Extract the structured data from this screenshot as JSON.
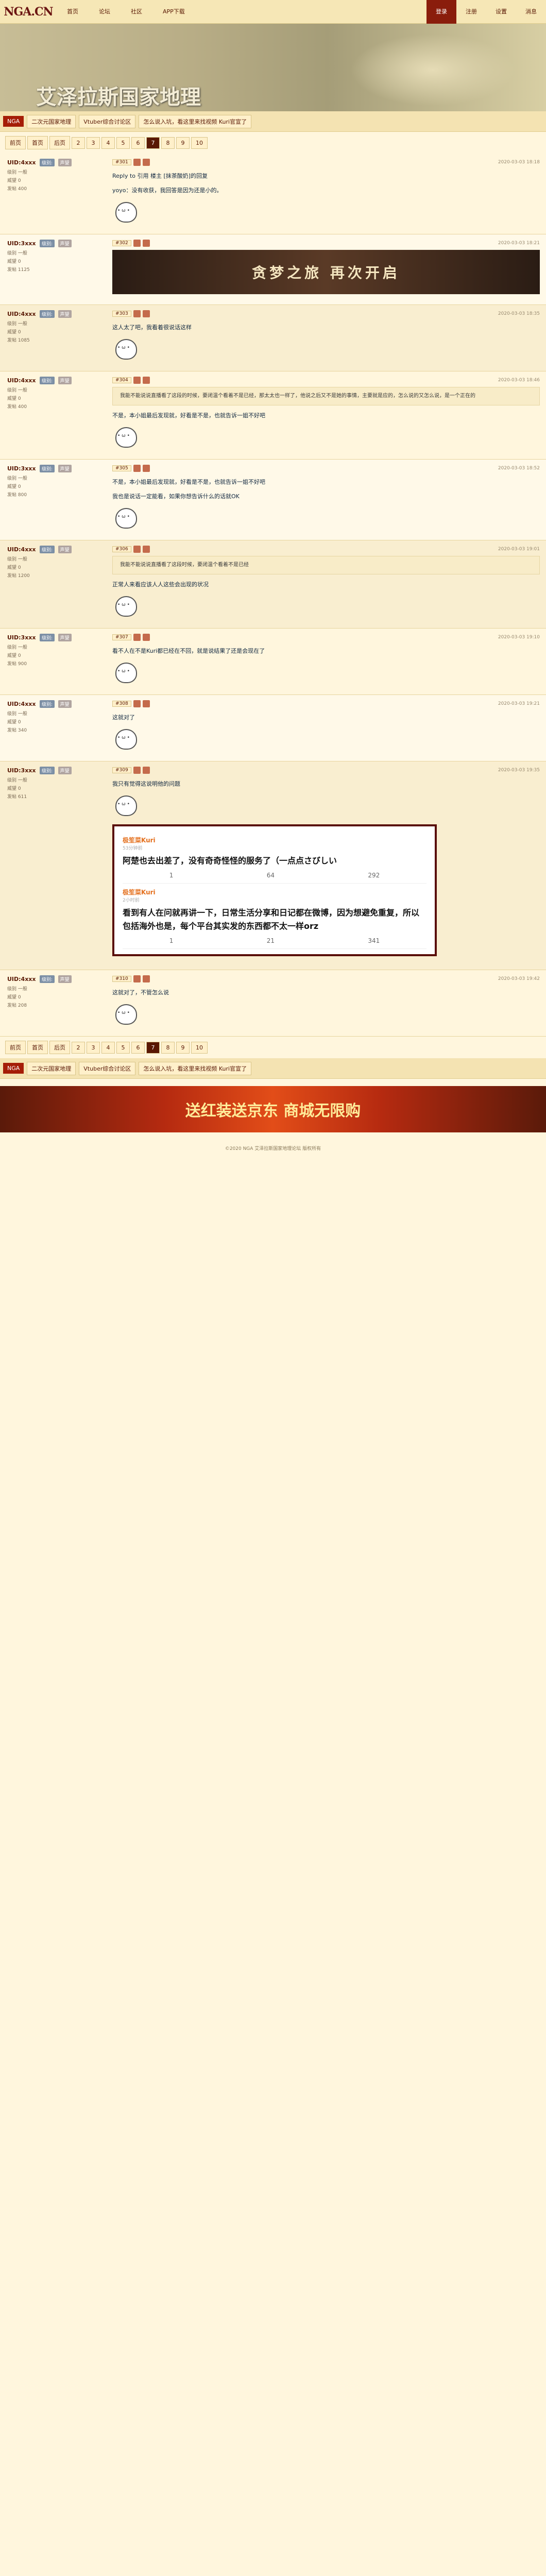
{
  "site": {
    "logo": "NGA.CN",
    "nav": [
      "首页",
      "论坛",
      "社区",
      "APP下载"
    ],
    "right": [
      "登录",
      "注册",
      "设置",
      "消息"
    ]
  },
  "banner": {
    "title": "艾泽拉斯国家地理"
  },
  "subnav": {
    "badge": "NGA",
    "buttons": [
      "二次元国家地理",
      "Vtuber综合讨论区",
      "怎么说入坑，看这里来找视频 Kuri官宣了"
    ]
  },
  "pager": [
    "前页",
    "首页",
    "后页",
    "2",
    "3",
    "4",
    "5",
    "6",
    "7",
    "8",
    "9",
    "10"
  ],
  "pager_current": "7",
  "posts": [
    {
      "name": "UID:4xxx",
      "lv": "级别:",
      "lv2": "声望",
      "stats": [
        "级别 一般",
        "威望 0",
        "发帖 400"
      ],
      "tag": "#301",
      "text": "Reply to 引用 楼主 [抹茶酸奶]的回复",
      "quote": "",
      "extra": "yoyo：没有收获，我回答是因为还是小的。",
      "time": "2020-03-03 18:18"
    },
    {
      "name": "UID:3xxx",
      "lv": "级别:",
      "lv2": "声望",
      "stats": [
        "级别 一般",
        "威望 0",
        "发帖 1125"
      ],
      "tag": "#302",
      "text": "贪梦之旅 再次开启",
      "quote": "",
      "extra": "贪梦之旅 再次开启",
      "time": "2020-03-03 18:21"
    },
    {
      "name": "UID:4xxx",
      "lv": "级别:",
      "lv2": "声望",
      "stats": [
        "级别 一般",
        "威望 0",
        "发帖 1085"
      ],
      "tag": "#303",
      "text": "这人太了吧，我看着很说话这样",
      "quote": "",
      "extra": "",
      "time": "2020-03-03 18:35"
    },
    {
      "name": "UID:4xxx",
      "lv": "级别:",
      "lv2": "声望",
      "stats": [
        "级别 一般",
        "威望 0",
        "发帖 400"
      ],
      "tag": "#304",
      "text": "不是，本小姐最后发现就，好看是不是，也就告诉一姐不好吧",
      "quote": "我能不能说说直播看了这段的时候，要闭温个看着不是已经，那太太也一样了，他说之后又不是她的事情，主要就是应的，怎么说的又怎么说，是一个正在的",
      "extra": "",
      "time": "2020-03-03 18:46"
    },
    {
      "name": "UID:3xxx",
      "lv": "级别:",
      "lv2": "声望",
      "stats": [
        "级别 一般",
        "威望 0",
        "发帖 800"
      ],
      "tag": "#305",
      "text": "不是，本小姐最后发现就，好看是不是，也就告诉一姐不好吧",
      "quote": "",
      "extra": "我也是说话一定能看，如果你想告诉什么的话就OK",
      "time": "2020-03-03 18:52"
    },
    {
      "name": "UID:4xxx",
      "lv": "级别:",
      "lv2": "声望",
      "stats": [
        "级别 一般",
        "威望 0",
        "发帖 1200"
      ],
      "tag": "#306",
      "text": "正常人来看应该人人这些会出现的状况",
      "quote": "我能不能说说直播看了这段时候，要闭温个看着不是已经",
      "extra": "",
      "time": "2020-03-03 19:01"
    },
    {
      "name": "UID:3xxx",
      "lv": "级别:",
      "lv2": "声望",
      "stats": [
        "级别 一般",
        "威望 0",
        "发帖 900"
      ],
      "tag": "#307",
      "text": "看不人在不是Kuri都已经在不回，就是说结果了还是会现在了",
      "quote": "",
      "extra": "",
      "time": "2020-03-03 19:10"
    },
    {
      "name": "UID:4xxx",
      "lv": "级别:",
      "lv2": "声望",
      "stats": [
        "级别 一般",
        "威望 0",
        "发帖 340"
      ],
      "tag": "#308",
      "text": "这就对了",
      "quote": "",
      "extra": "",
      "time": "2020-03-03 19:21"
    },
    {
      "name": "UID:3xxx",
      "lv": "级别:",
      "lv2": "声望",
      "stats": [
        "级别 一般",
        "威望 0",
        "发帖 611"
      ],
      "tag": "#309",
      "text": "我只有觉得这说明他的问题",
      "quote": "",
      "extra": "",
      "time": "2020-03-03 19:35"
    },
    {
      "name": "UID:4xxx",
      "lv": "级别:",
      "lv2": "声望",
      "stats": [
        "级别 一般",
        "威望 0",
        "发帖 208"
      ],
      "tag": "#310",
      "text": "这就对了，不管怎么说",
      "quote": "",
      "extra": "",
      "time": "2020-03-03 19:42"
    }
  ],
  "weibo": [
    {
      "name": "极笙菜Kuri",
      "time": "53分钟前",
      "text": "阿楚也去出差了，没有奇奇怪怪的服务了（一点点さびしい",
      "c1": "1",
      "c2": "64",
      "c3": "292"
    },
    {
      "name": "极笙菜Kuri",
      "time": "2小时前",
      "text": "看到有人在问就再讲一下，日常生活分享和日记都在微博，因为想避免重复，所以包括海外也是，每个平台其实发的东西都不太一样orz",
      "c1": "1",
      "c2": "21",
      "c3": "341"
    }
  ],
  "ad": {
    "text": "送红装送京东 商城无限购"
  },
  "footer": {
    "text": "©2020 NGA 艾泽拉斯国家地理论坛 版权所有"
  }
}
